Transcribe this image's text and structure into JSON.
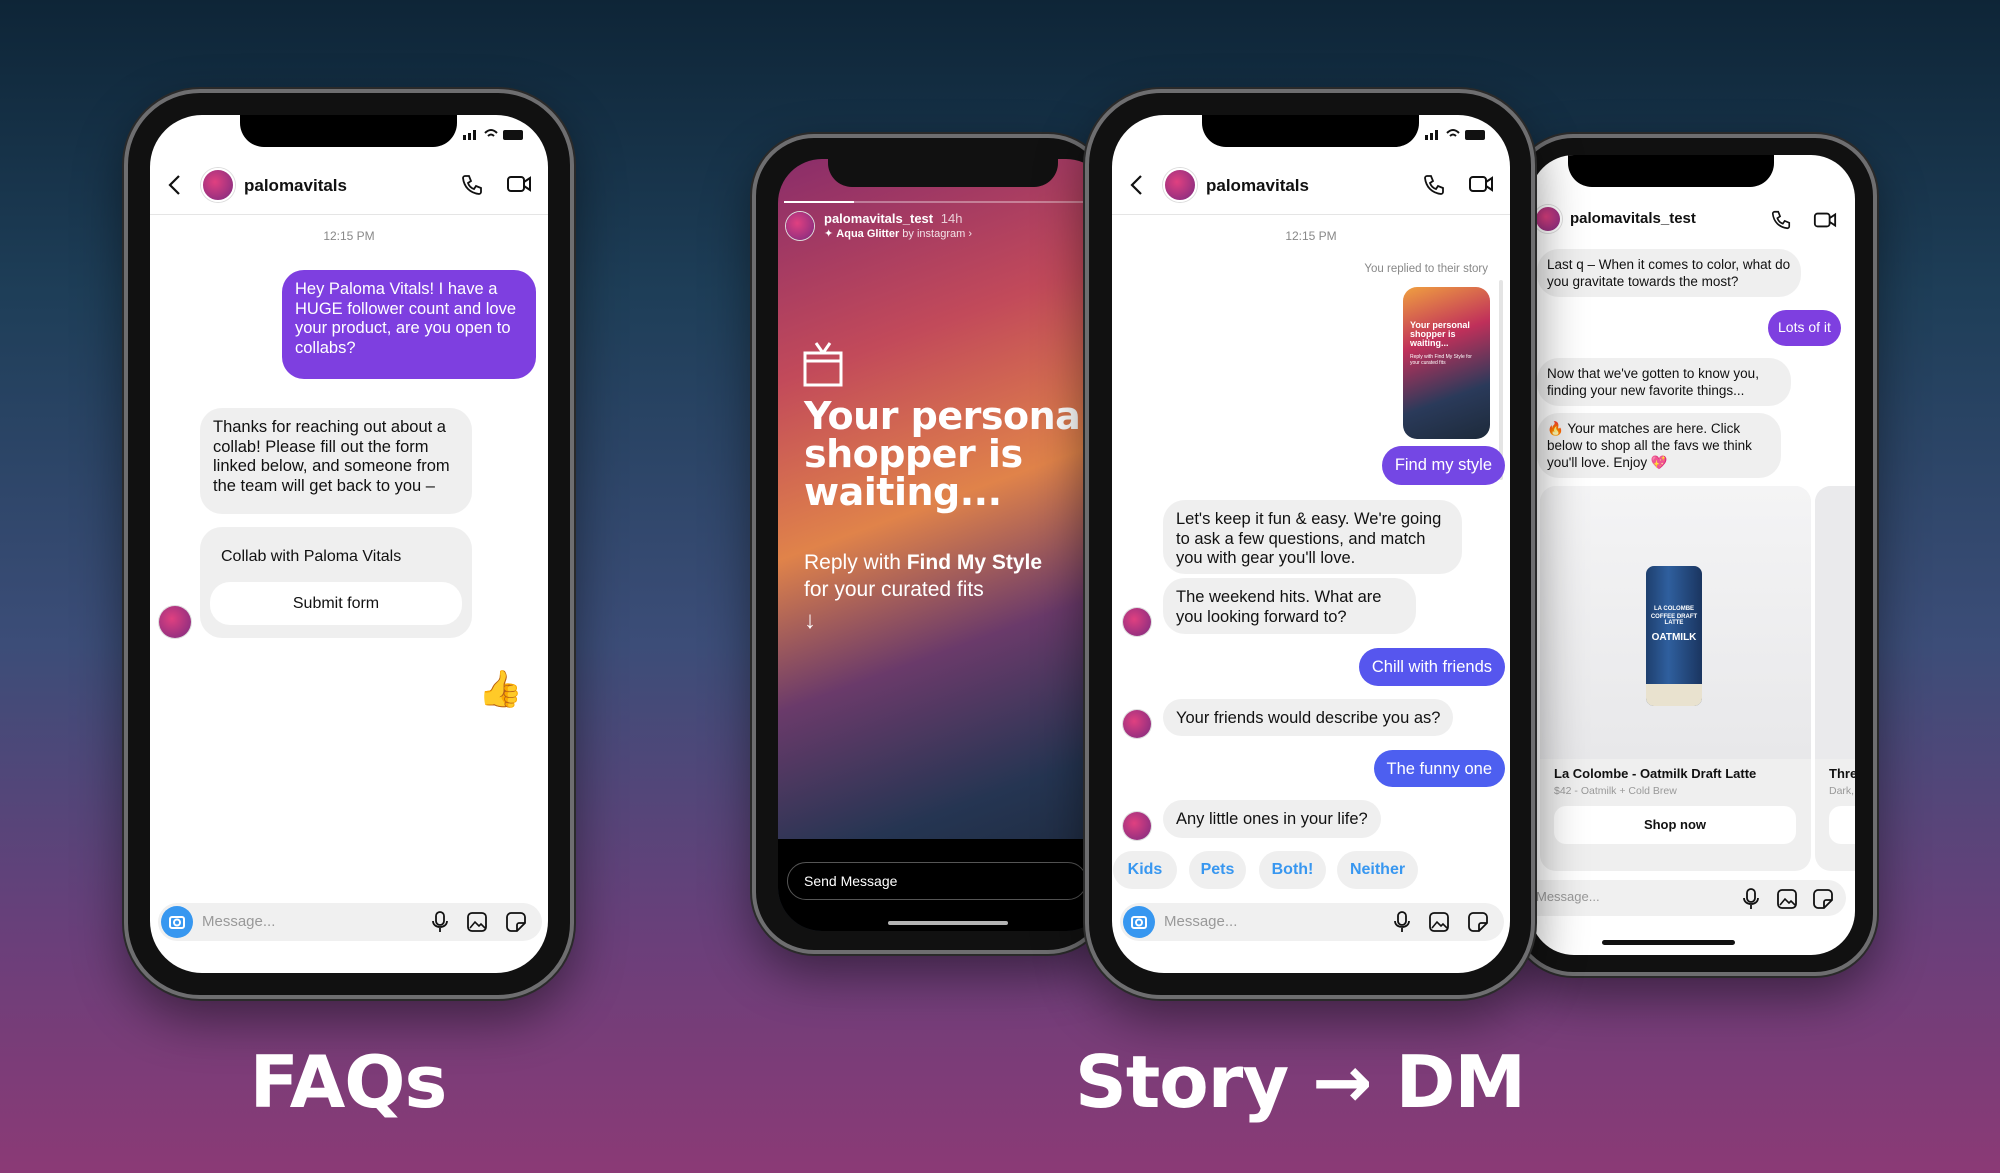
{
  "labels": {
    "faqs": "FAQs",
    "story_dm": "Story → DM"
  },
  "colors": {
    "sent_purple": "#7e3fe0",
    "sent_blue": "#4d5ff0",
    "quick_reply": "#3897f0"
  },
  "faq_phone": {
    "username": "palomavitals",
    "timestamp": "12:15 PM",
    "sent_message": "Hey Paloma Vitals! I have a HUGE follower count and love your product, are you open to collabs?",
    "reply_message": "Thanks for reaching out about a collab! Please fill out the form linked below, and someone from the team will get back to you –",
    "card_title": "Collab with Paloma Vitals",
    "card_button": "Submit form",
    "reaction": "👍",
    "composer_placeholder": "Message..."
  },
  "story_phone": {
    "username": "palomavitals_test",
    "age": "14h",
    "music": "Aqua Glitter",
    "music_by": "by instagram ›",
    "headline": [
      "Your personal",
      "shopper is",
      "waiting..."
    ],
    "subtext_prefix": "Reply with ",
    "subtext_bold": "Find My Style",
    "subtext_line2": "for your curated fits",
    "arrow": "↓",
    "send_placeholder": "Send Message"
  },
  "dm_phone": {
    "username": "palomavitals",
    "timestamp": "12:15 PM",
    "replied_note": "You replied to their story",
    "thumb_headline": "Your personal shopper is waiting...",
    "thumb_sub": "Reply with Find My Style for your curated fits",
    "messages": [
      {
        "from": "me",
        "text": "Find my style"
      },
      {
        "from": "them",
        "text": "Let's keep it fun & easy. We're going to ask a few questions, and match you with gear you'll love."
      },
      {
        "from": "them",
        "text": "The weekend hits. What are you looking forward to?"
      },
      {
        "from": "me",
        "text": "Chill with friends"
      },
      {
        "from": "them",
        "text": "Your friends would describe you as?"
      },
      {
        "from": "me",
        "text": "The funny one"
      },
      {
        "from": "them",
        "text": "Any little ones in your life?"
      }
    ],
    "quick_replies": [
      "Kids",
      "Pets",
      "Both!",
      "Neither"
    ],
    "composer_placeholder": "Message..."
  },
  "shop_phone": {
    "username": "palomavitals_test",
    "messages": [
      {
        "from": "them",
        "text": "Last q – When it comes to color, what do you gravitate towards the most?"
      },
      {
        "from": "me",
        "text": "Lots of it"
      },
      {
        "from": "them",
        "text": "Now that we've gotten to know you, finding your new favorite things..."
      },
      {
        "from": "them",
        "text": "🔥 Your matches are here. Click below to shop all the favs we think you'll love. Enjoy 💖"
      }
    ],
    "products": [
      {
        "title": "La Colombe - Oatmilk Draft Latte",
        "subtitle": "$42 - Oatmilk + Cold Brew",
        "button": "Shop now",
        "can_brand": "LA COLOMBE",
        "can_sub": "COFFEE DRAFT LATTE",
        "can_flavor": "OATMILK"
      },
      {
        "title": "Thre",
        "subtitle": "Dark,"
      }
    ],
    "composer_placeholder": "Message..."
  }
}
